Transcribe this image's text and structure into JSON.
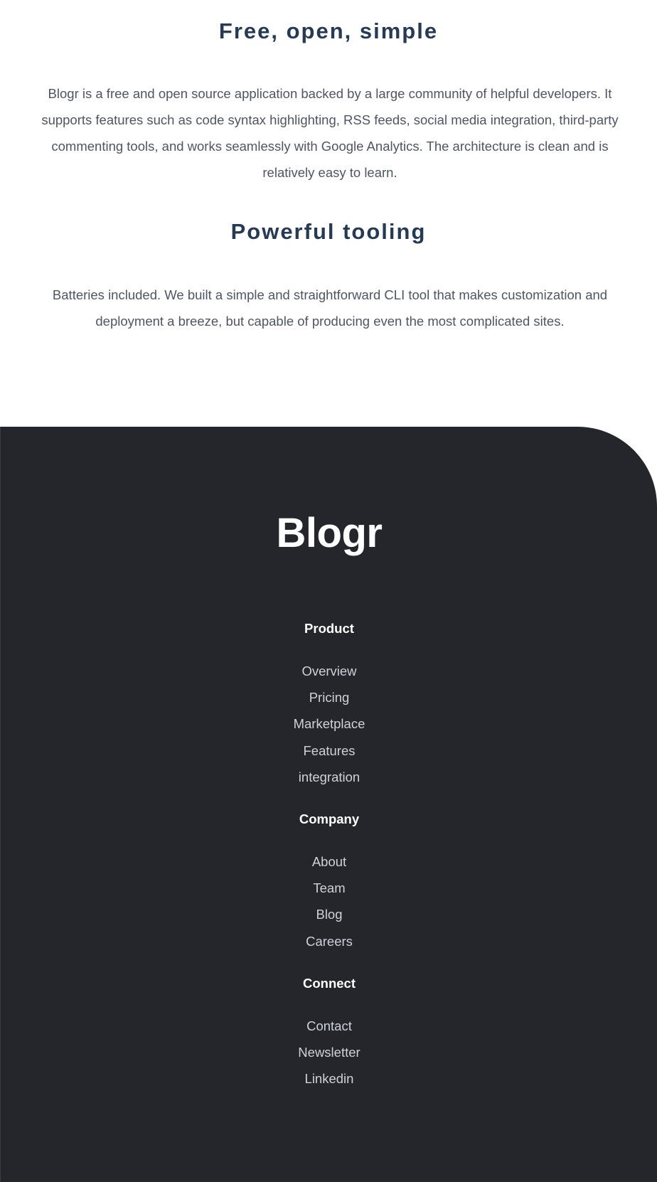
{
  "features": [
    {
      "title": "Free, open, simple",
      "body": "Blogr is a free and open source application backed by a large community of helpful developers. It supports features such as code syntax highlighting, RSS feeds, social media integration, third-party commenting tools, and works seamlessly with Google Analytics. The architecture is clean and is relatively easy to learn."
    },
    {
      "title": "Powerful tooling",
      "body": "Batteries included. We built a simple and straightforward CLI tool that makes customization and deployment a breeze, but capable of producing even the most complicated sites."
    }
  ],
  "footer": {
    "logo": "Blogr",
    "groups": [
      {
        "heading": "Product",
        "links": [
          "Overview",
          "Pricing",
          "Marketplace",
          "Features",
          "integration"
        ]
      },
      {
        "heading": "Company",
        "links": [
          "About",
          "Team",
          "Blog",
          "Careers"
        ]
      },
      {
        "heading": "Connect",
        "links": [
          "Contact",
          "Newsletter",
          "Linkedin"
        ]
      }
    ]
  },
  "colors": {
    "heading": "#243a57",
    "body_text": "#4f5566",
    "footer_bg": "#25262c",
    "footer_heading": "#ffffff",
    "footer_link": "#cfd1d8"
  }
}
